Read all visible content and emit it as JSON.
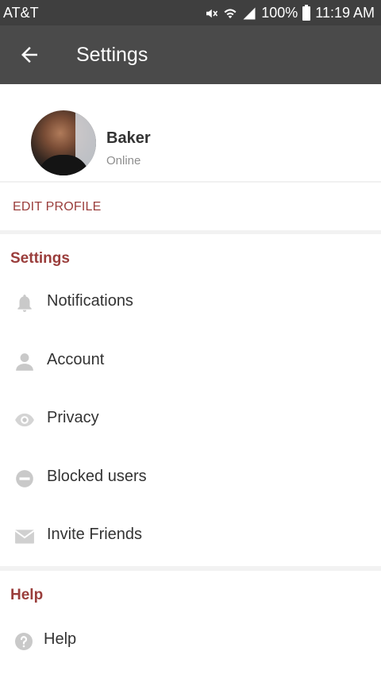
{
  "status_bar": {
    "carrier": "AT&T",
    "battery": "100%",
    "time": "11:19 AM"
  },
  "app_bar": {
    "title": "Settings"
  },
  "profile": {
    "name": "Baker",
    "status": "Online",
    "edit_label": "EDIT PROFILE"
  },
  "settings": {
    "title": "Settings",
    "items": [
      {
        "label": "Notifications",
        "icon": "bell-icon"
      },
      {
        "label": "Account",
        "icon": "person-icon"
      },
      {
        "label": "Privacy",
        "icon": "eye-icon"
      },
      {
        "label": "Blocked users",
        "icon": "blocked-icon"
      },
      {
        "label": "Invite Friends",
        "icon": "mail-icon"
      }
    ]
  },
  "help": {
    "title": "Help",
    "items": [
      {
        "label": "Help",
        "icon": "help-icon"
      }
    ]
  },
  "colors": {
    "accent": "#9a3d3b",
    "app_bar": "#4a4a4a",
    "status_bar": "#3f3f3f",
    "icon_gray": "#c9c9c9"
  }
}
